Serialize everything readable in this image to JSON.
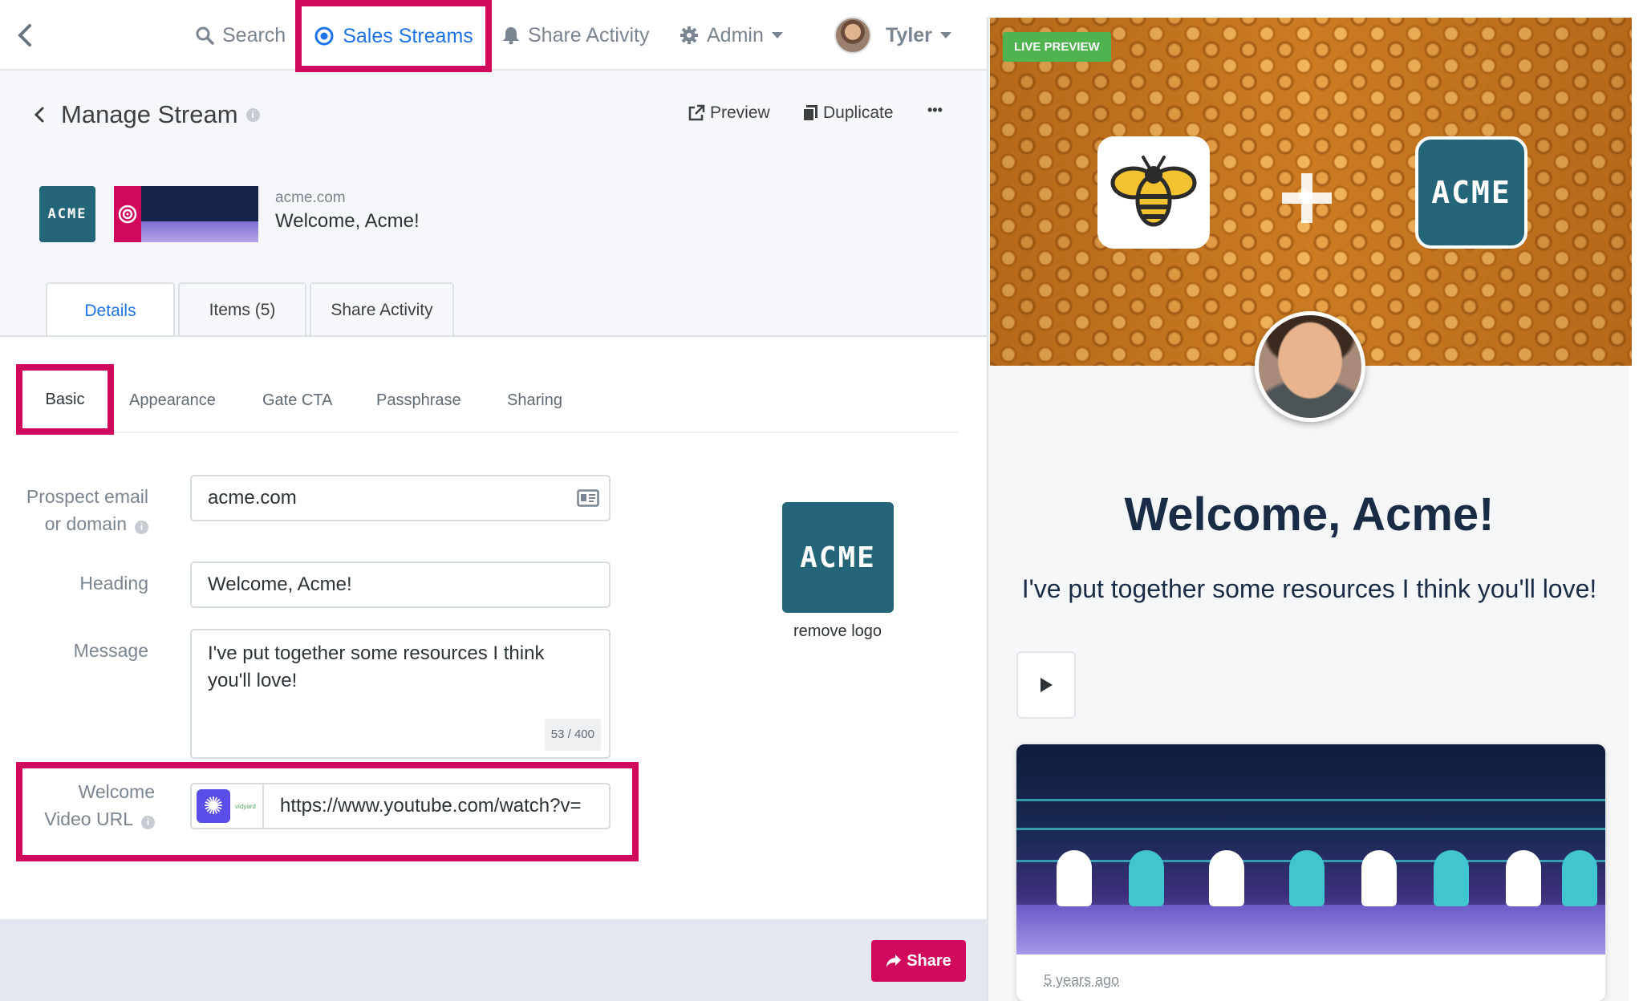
{
  "nav": {
    "search": "Search",
    "sales_streams": "Sales Streams",
    "share_activity": "Share Activity",
    "admin": "Admin",
    "user": "Tyler"
  },
  "header": {
    "title": "Manage Stream",
    "preview": "Preview",
    "duplicate": "Duplicate",
    "more": "•••"
  },
  "summary": {
    "domain": "acme.com",
    "title": "Welcome, Acme!",
    "logo_text": "ACME"
  },
  "tabs": [
    "Details",
    "Items (5)",
    "Share Activity"
  ],
  "subtabs": [
    "Basic",
    "Appearance",
    "Gate CTA",
    "Passphrase",
    "Sharing"
  ],
  "form": {
    "email_label_1": "Prospect email",
    "email_label_2": "or domain",
    "email_value": "acme.com",
    "heading_label": "Heading",
    "heading_value": "Welcome, Acme!",
    "message_label": "Message",
    "message_value": "I've put together some resources I think you'll love!",
    "char_count": "53 / 400",
    "video_label_1": "Welcome",
    "video_label_2": "Video URL",
    "video_provider": "vidyard",
    "video_url": "https://www.youtube.com/watch?v="
  },
  "side": {
    "logo_text": "ACME",
    "remove_logo": "remove logo"
  },
  "footer": {
    "share": "Share"
  },
  "preview": {
    "badge": "LIVE PREVIEW",
    "heading": "Welcome, Acme!",
    "message": "I've put together some resources I think you'll love!",
    "logo_text": "ACME",
    "item_time": "5 years ago"
  },
  "colors": {
    "accent_blue": "#1f73e8",
    "highlight": "#d0095c",
    "acme_teal": "#24657a",
    "live_green": "#4fb34f"
  }
}
